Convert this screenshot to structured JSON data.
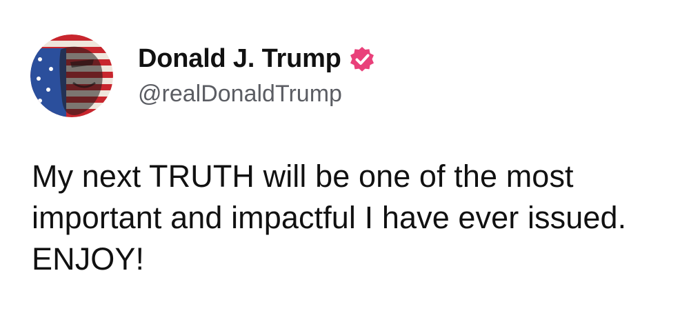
{
  "author": {
    "display_name": "Donald J. Trump",
    "handle": "@realDonaldTrump",
    "verified": true,
    "verified_color": "#e9407a",
    "avatar_icon": "flag-portrait-avatar"
  },
  "post": {
    "text": "My next TRUTH will be one of the most important and impactful I have ever issued. ENJOY!"
  },
  "colors": {
    "background": "#ffffff",
    "text": "#111111",
    "handle": "#5b5d63"
  }
}
